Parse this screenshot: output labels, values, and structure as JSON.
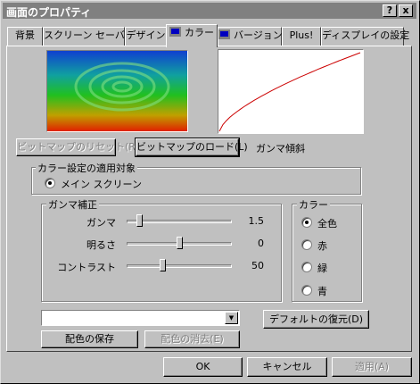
{
  "window": {
    "title": "画面のプロパティ",
    "help_glyph": "?",
    "close_glyph": "x"
  },
  "tabs": [
    {
      "label": "背景"
    },
    {
      "label": "スクリーン セーバー"
    },
    {
      "label": "デザイン"
    },
    {
      "label": "カラー",
      "active": true
    },
    {
      "label": "バージョン"
    },
    {
      "label": "Plus!"
    },
    {
      "label": "ディスプレイの設定"
    }
  ],
  "bitmap_buttons": {
    "reset_label": "ビットマップのリセット(R)",
    "load_label": "ビットマップのロード(L)"
  },
  "gamma_curve_label": "ガンマ傾斜",
  "apply_target": {
    "legend": "カラー設定の適用対象",
    "option_label": "メイン スクリーン"
  },
  "gamma": {
    "legend": "ガンマ補正",
    "sliders": [
      {
        "label": "ガンマ",
        "value_text": "1.5",
        "fraction": 0.1
      },
      {
        "label": "明るさ",
        "value_text": "0",
        "fraction": 0.5
      },
      {
        "label": "コントラスト",
        "value_text": "50",
        "fraction": 0.33
      }
    ]
  },
  "color": {
    "legend": "カラー",
    "options": [
      {
        "label": "全色",
        "selected": true
      },
      {
        "label": "赤",
        "selected": false
      },
      {
        "label": "緑",
        "selected": false
      },
      {
        "label": "青",
        "selected": false
      }
    ]
  },
  "scheme": {
    "selected_value": "",
    "save_label": "配色の保存",
    "delete_label": "配色の消去(E)",
    "restore_label": "デフォルトの復元(D)"
  },
  "footer": {
    "ok_label": "OK",
    "cancel_label": "キャンセル",
    "apply_label": "適用(A)"
  },
  "colors": {
    "face": "#c0c0c0",
    "title_inactive": "#808080",
    "curve": "#cc0000"
  }
}
